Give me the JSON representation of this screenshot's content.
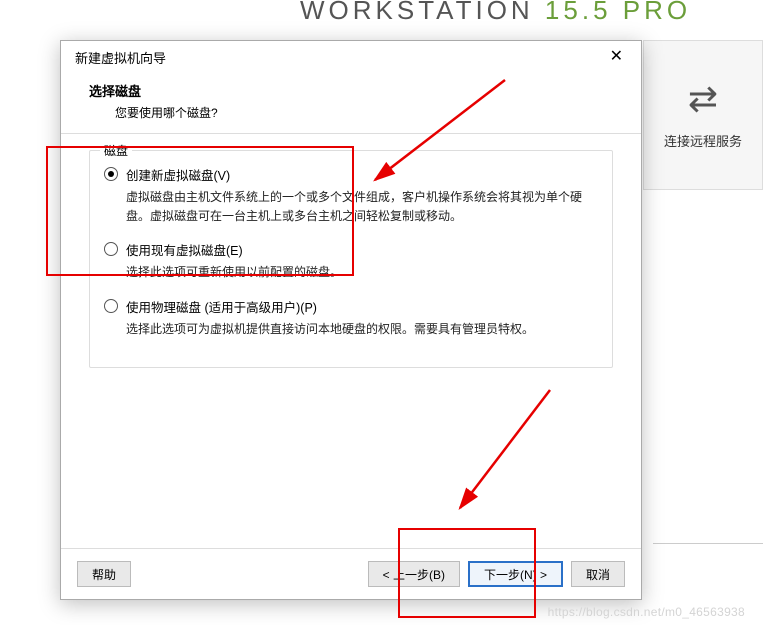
{
  "bg": {
    "title_main": "WORKSTATION ",
    "title_ver": "15.5 ",
    "title_pro": "PRO",
    "side_label": "连接远程服务"
  },
  "dialog": {
    "title": "新建虚拟机向导",
    "header_title": "选择磁盘",
    "header_sub": "您要使用哪个磁盘?",
    "group_title": "磁盘",
    "options": [
      {
        "label": "创建新虚拟磁盘(V)",
        "desc": "虚拟磁盘由主机文件系统上的一个或多个文件组成，客户机操作系统会将其视为单个硬盘。虚拟磁盘可在一台主机上或多台主机之间轻松复制或移动。",
        "selected": true
      },
      {
        "label": "使用现有虚拟磁盘(E)",
        "desc": "选择此选项可重新使用以前配置的磁盘。",
        "selected": false
      },
      {
        "label": "使用物理磁盘 (适用于高级用户)(P)",
        "desc": "选择此选项可为虚拟机提供直接访问本地硬盘的权限。需要具有管理员特权。",
        "selected": false
      }
    ],
    "buttons": {
      "help": "帮助",
      "back": "< 上一步(B)",
      "next": "下一步(N) >",
      "cancel": "取消"
    }
  },
  "watermark": "https://blog.csdn.net/m0_46563938"
}
